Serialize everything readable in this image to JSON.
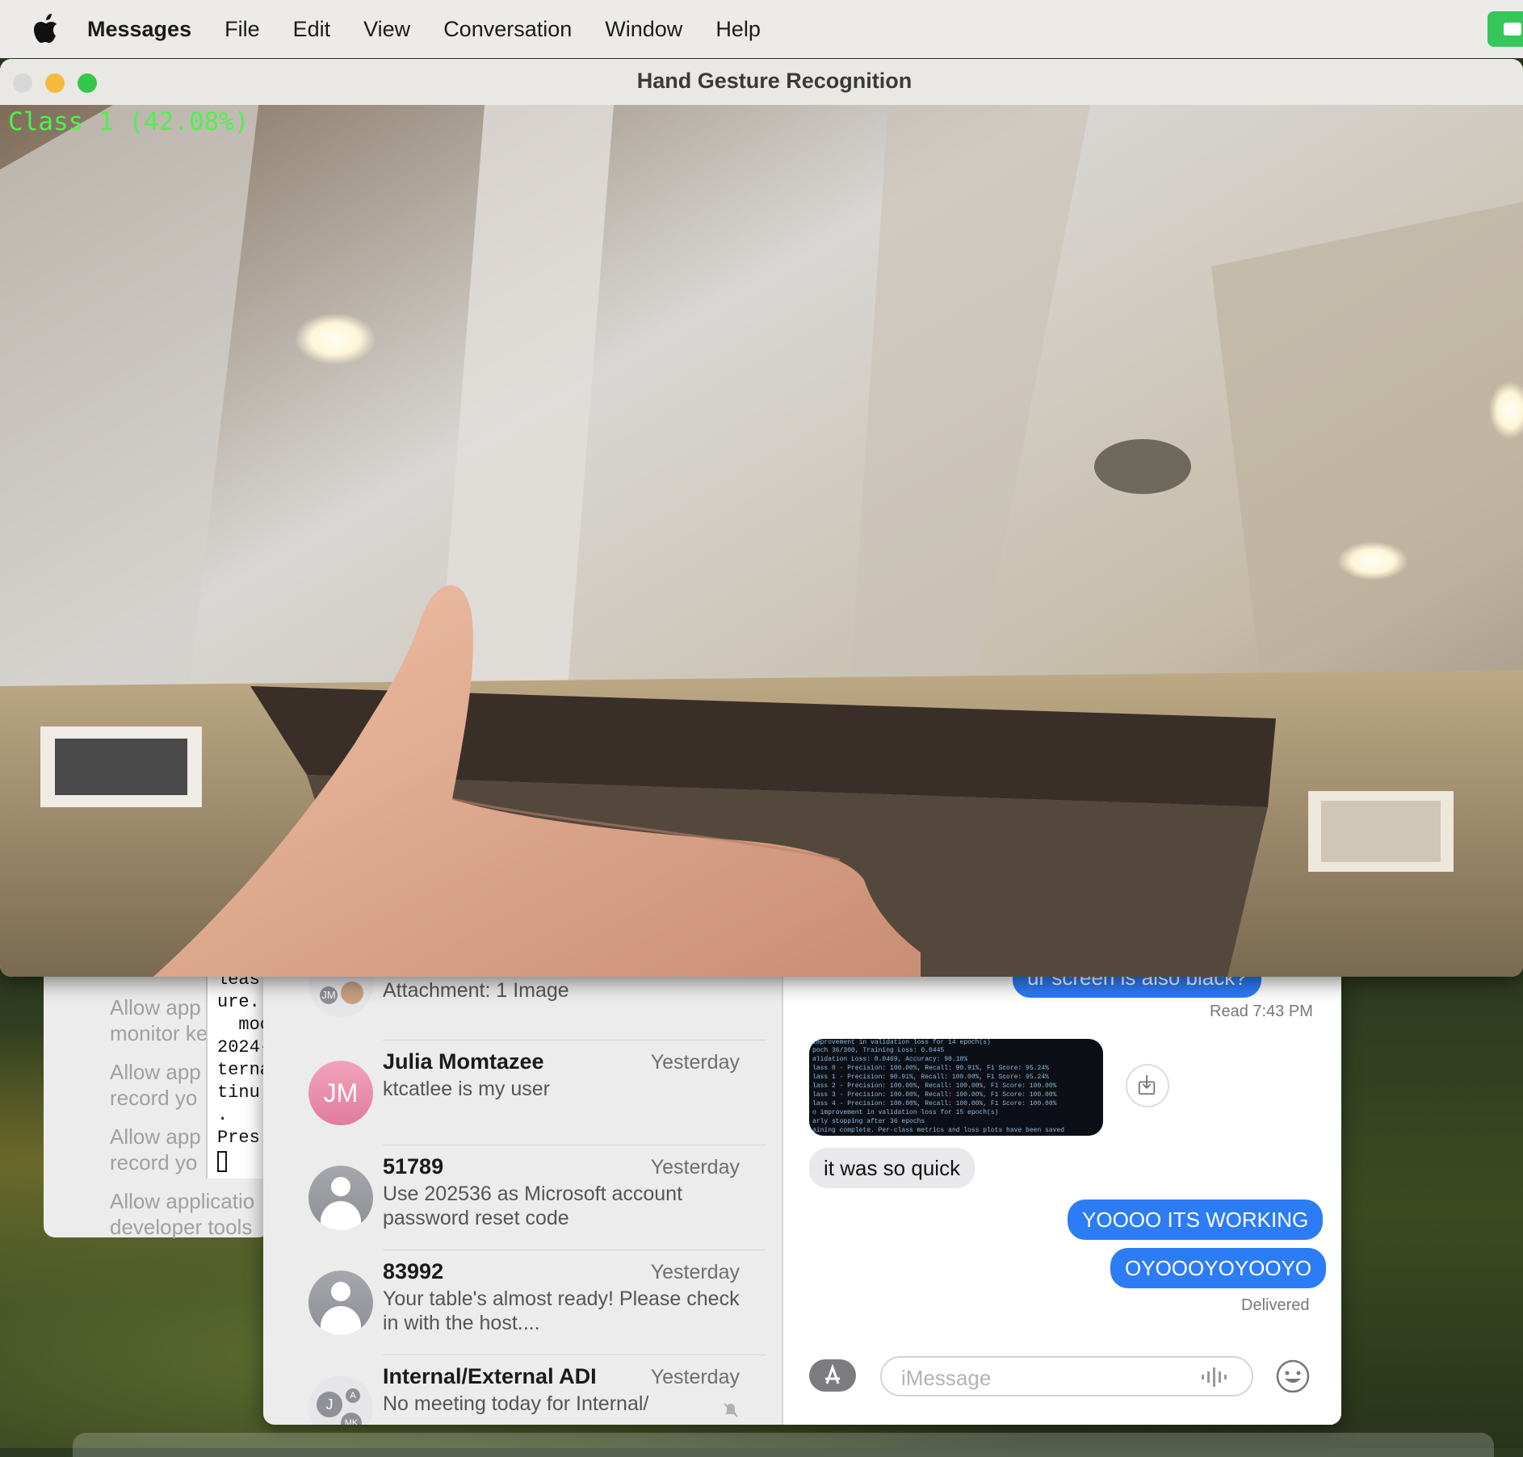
{
  "menubar": {
    "app_name": "Messages",
    "items": [
      "File",
      "Edit",
      "View",
      "Conversation",
      "Window",
      "Help"
    ]
  },
  "settings_panel": {
    "rows": [
      "Allow app",
      "monitor ke",
      "Allow app",
      "record yo",
      "Allow app",
      "record yo",
      "Allow applicatio",
      "developer tools"
    ]
  },
  "terminal": {
    "lines": [
      "leas",
      "ure.",
      "  moc",
      "2024-",
      "terna",
      "tinu",
      ".",
      "Pres"
    ]
  },
  "gesture_window": {
    "title": "Hand Gesture Recognition",
    "prediction": "Class  1  (42.08%)"
  },
  "conversations": [
    {
      "name": "",
      "time": "",
      "preview": "Attachment: 1 Image",
      "avatar_initials": "JM"
    },
    {
      "name": "Julia Momtazee",
      "time": "Yesterday",
      "preview": "ktcatlee is my user",
      "avatar_initials": "JM"
    },
    {
      "name": "51789",
      "time": "Yesterday",
      "preview": "Use 202536 as Microsoft account password reset code"
    },
    {
      "name": "83992",
      "time": "Yesterday",
      "preview": "Your table's almost ready! Please check in with the host...."
    },
    {
      "name": "Internal/External ADI",
      "time": "Yesterday",
      "preview": "No meeting today for Internal/",
      "group_initials": [
        "J",
        "A",
        "MK"
      ]
    }
  ],
  "thread": {
    "top_message": "ur screen is also black?",
    "read_receipt": "Read 7:43 PM",
    "image_lines": [
      "improvement in validation loss for 14 epoch(s)",
      "poch 36/300, Training Loss: 0.0445",
      "alidation Loss: 0.0469, Accuracy: 98.18%",
      "lass 0 - Precision: 100.00%, Recall: 90.91%, F1 Score: 95.24%",
      "lass 1 - Precision: 90.91%, Recall: 100.00%, F1 Score: 95.24%",
      "lass 2 - Precision: 100.00%, Recall: 100.00%, F1 Score: 100.00%",
      "lass 3 - Precision: 100.00%, Recall: 100.00%, F1 Score: 100.00%",
      "lass 4 - Precision: 100.00%, Recall: 100.00%, F1 Score: 100.00%",
      "o improvement in validation loss for 15 epoch(s)",
      "arly stopping after 36 epochs",
      "aining complete. Per-class metrics and loss plots have been saved"
    ],
    "incoming": "it was so quick",
    "outgoing": [
      "YOOOO ITS WORKING",
      "OYOOOYOYOOYO"
    ],
    "delivered": "Delivered",
    "compose_placeholder": "iMessage"
  },
  "colors": {
    "imessage_blue": "#2c7cf6",
    "overlay_green": "#4cf24f",
    "traffic_yellow": "#f6bb3b",
    "traffic_green": "#34c84a"
  },
  "icons": [
    "apple-icon",
    "download-icon",
    "app-store-icon",
    "audio-waveform-icon",
    "emoji-icon",
    "mute-bell-icon",
    "person-icon"
  ]
}
